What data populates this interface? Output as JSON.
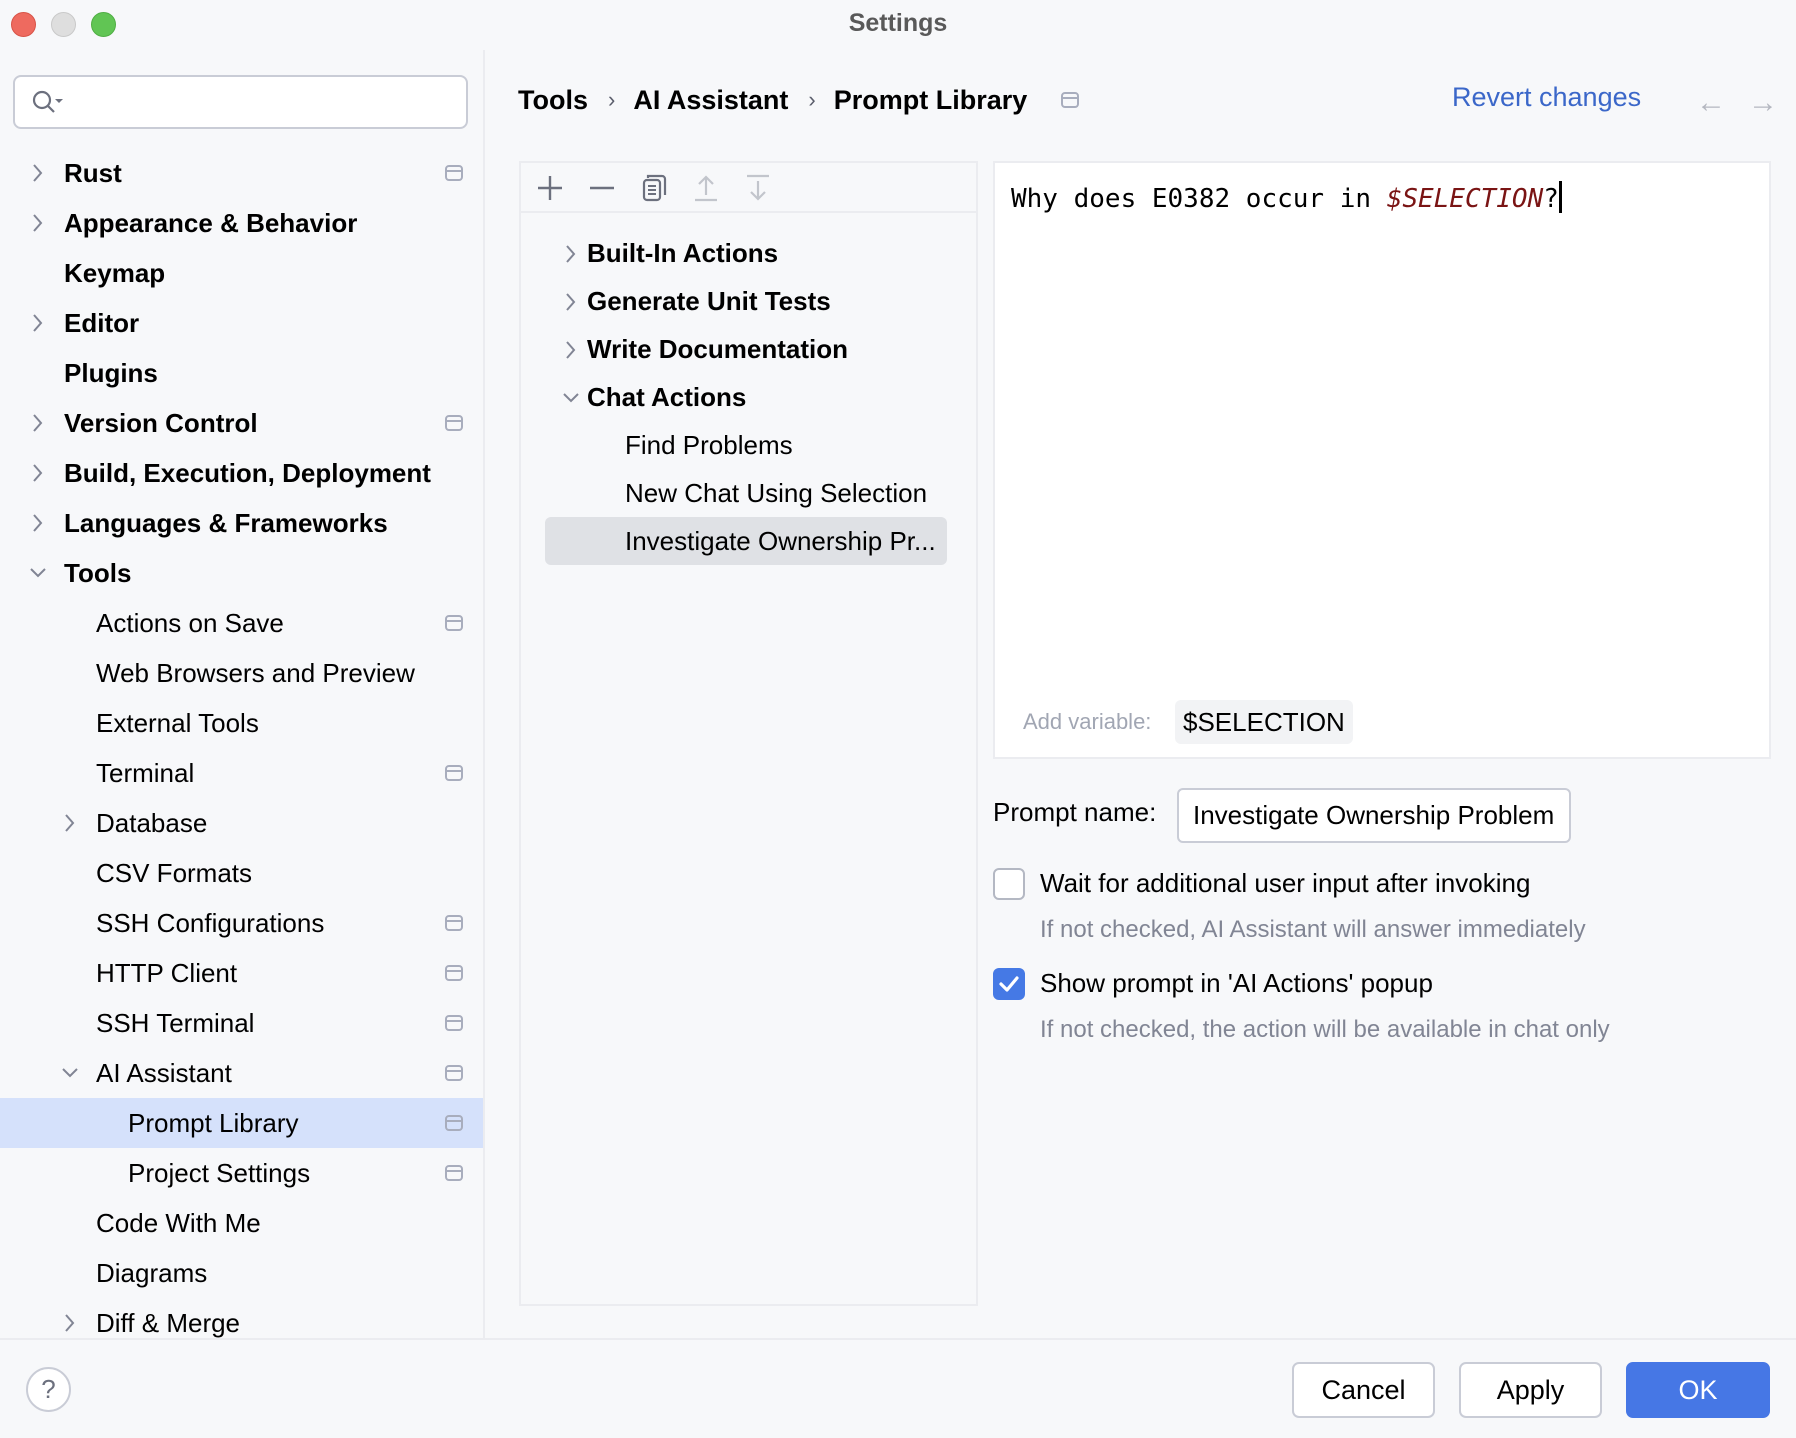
{
  "window": {
    "title": "Settings",
    "traffic_lights": [
      "close",
      "minimize",
      "zoom"
    ]
  },
  "sidebar": {
    "search": {
      "value": "",
      "placeholder": ""
    },
    "items": [
      {
        "label": "Rust",
        "level": 0,
        "expander": "collapsed",
        "bold": true,
        "project_icon": true
      },
      {
        "label": "Appearance & Behavior",
        "level": 0,
        "expander": "collapsed",
        "bold": true,
        "project_icon": false
      },
      {
        "label": "Keymap",
        "level": 0,
        "expander": "none",
        "bold": true,
        "project_icon": false
      },
      {
        "label": "Editor",
        "level": 0,
        "expander": "collapsed",
        "bold": true,
        "project_icon": false
      },
      {
        "label": "Plugins",
        "level": 0,
        "expander": "none",
        "bold": true,
        "project_icon": false
      },
      {
        "label": "Version Control",
        "level": 0,
        "expander": "collapsed",
        "bold": true,
        "project_icon": true
      },
      {
        "label": "Build, Execution, Deployment",
        "level": 0,
        "expander": "collapsed",
        "bold": true,
        "project_icon": false
      },
      {
        "label": "Languages & Frameworks",
        "level": 0,
        "expander": "collapsed",
        "bold": true,
        "project_icon": false
      },
      {
        "label": "Tools",
        "level": 0,
        "expander": "expanded",
        "bold": true,
        "project_icon": false
      },
      {
        "label": "Actions on Save",
        "level": 1,
        "expander": "none",
        "bold": false,
        "project_icon": true
      },
      {
        "label": "Web Browsers and Preview",
        "level": 1,
        "expander": "none",
        "bold": false,
        "project_icon": false
      },
      {
        "label": "External Tools",
        "level": 1,
        "expander": "none",
        "bold": false,
        "project_icon": false
      },
      {
        "label": "Terminal",
        "level": 1,
        "expander": "none",
        "bold": false,
        "project_icon": true
      },
      {
        "label": "Database",
        "level": 1,
        "expander": "collapsed",
        "bold": false,
        "project_icon": false
      },
      {
        "label": "CSV Formats",
        "level": 1,
        "expander": "none",
        "bold": false,
        "project_icon": false
      },
      {
        "label": "SSH Configurations",
        "level": 1,
        "expander": "none",
        "bold": false,
        "project_icon": true
      },
      {
        "label": "HTTP Client",
        "level": 1,
        "expander": "none",
        "bold": false,
        "project_icon": true
      },
      {
        "label": "SSH Terminal",
        "level": 1,
        "expander": "none",
        "bold": false,
        "project_icon": true
      },
      {
        "label": "AI Assistant",
        "level": 1,
        "expander": "expanded",
        "bold": false,
        "project_icon": true
      },
      {
        "label": "Prompt Library",
        "level": 2,
        "expander": "none",
        "bold": false,
        "project_icon": true,
        "selected": true
      },
      {
        "label": "Project Settings",
        "level": 2,
        "expander": "none",
        "bold": false,
        "project_icon": true
      },
      {
        "label": "Code With Me",
        "level": 1,
        "expander": "none",
        "bold": false,
        "project_icon": false
      },
      {
        "label": "Diagrams",
        "level": 1,
        "expander": "none",
        "bold": false,
        "project_icon": false
      },
      {
        "label": "Diff & Merge",
        "level": 1,
        "expander": "collapsed",
        "bold": false,
        "project_icon": false
      }
    ],
    "help_label": "?"
  },
  "header": {
    "breadcrumbs": [
      "Tools",
      "AI Assistant",
      "Prompt Library"
    ],
    "separator": "›",
    "revert_label": "Revert changes",
    "back_icon": "←",
    "forward_icon": "→"
  },
  "prompt_list": {
    "toolbar": [
      {
        "name": "add-icon",
        "enabled": true
      },
      {
        "name": "remove-icon",
        "enabled": true
      },
      {
        "name": "copy-icon",
        "enabled": true
      },
      {
        "name": "move-up-icon",
        "enabled": false
      },
      {
        "name": "move-down-icon",
        "enabled": false
      }
    ],
    "items": [
      {
        "label": "Built-In Actions",
        "level": 0,
        "expander": "collapsed",
        "bold": true
      },
      {
        "label": "Generate Unit Tests",
        "level": 0,
        "expander": "collapsed",
        "bold": true
      },
      {
        "label": "Write Documentation",
        "level": 0,
        "expander": "collapsed",
        "bold": true
      },
      {
        "label": "Chat Actions",
        "level": 0,
        "expander": "expanded",
        "bold": true
      },
      {
        "label": "Find Problems",
        "level": 1,
        "expander": "none",
        "bold": false
      },
      {
        "label": "New Chat Using Selection",
        "level": 1,
        "expander": "none",
        "bold": false
      },
      {
        "label": "Investigate Ownership Pr...",
        "level": 1,
        "expander": "none",
        "bold": false,
        "selected": true
      }
    ]
  },
  "editor": {
    "prompt_prefix": "Why does E0382 occur in ",
    "prompt_variable": "$SELECTION",
    "prompt_suffix": "?",
    "add_variable_label": "Add variable:",
    "variable_chip": "$SELECTION",
    "variable_color": "#7a1414"
  },
  "form": {
    "prompt_name_label": "Prompt name:",
    "prompt_name_value": "Investigate Ownership Problem",
    "wait_input": {
      "label": "Wait for additional user input after invoking",
      "hint": "If not checked, AI Assistant will answer immediately",
      "checked": false
    },
    "show_popup": {
      "label": "Show prompt in 'AI Actions' popup",
      "hint": "If not checked, the action will be available in chat only",
      "checked": true
    }
  },
  "footer": {
    "cancel_label": "Cancel",
    "apply_label": "Apply",
    "ok_label": "OK",
    "accent_color": "#4677e5"
  }
}
